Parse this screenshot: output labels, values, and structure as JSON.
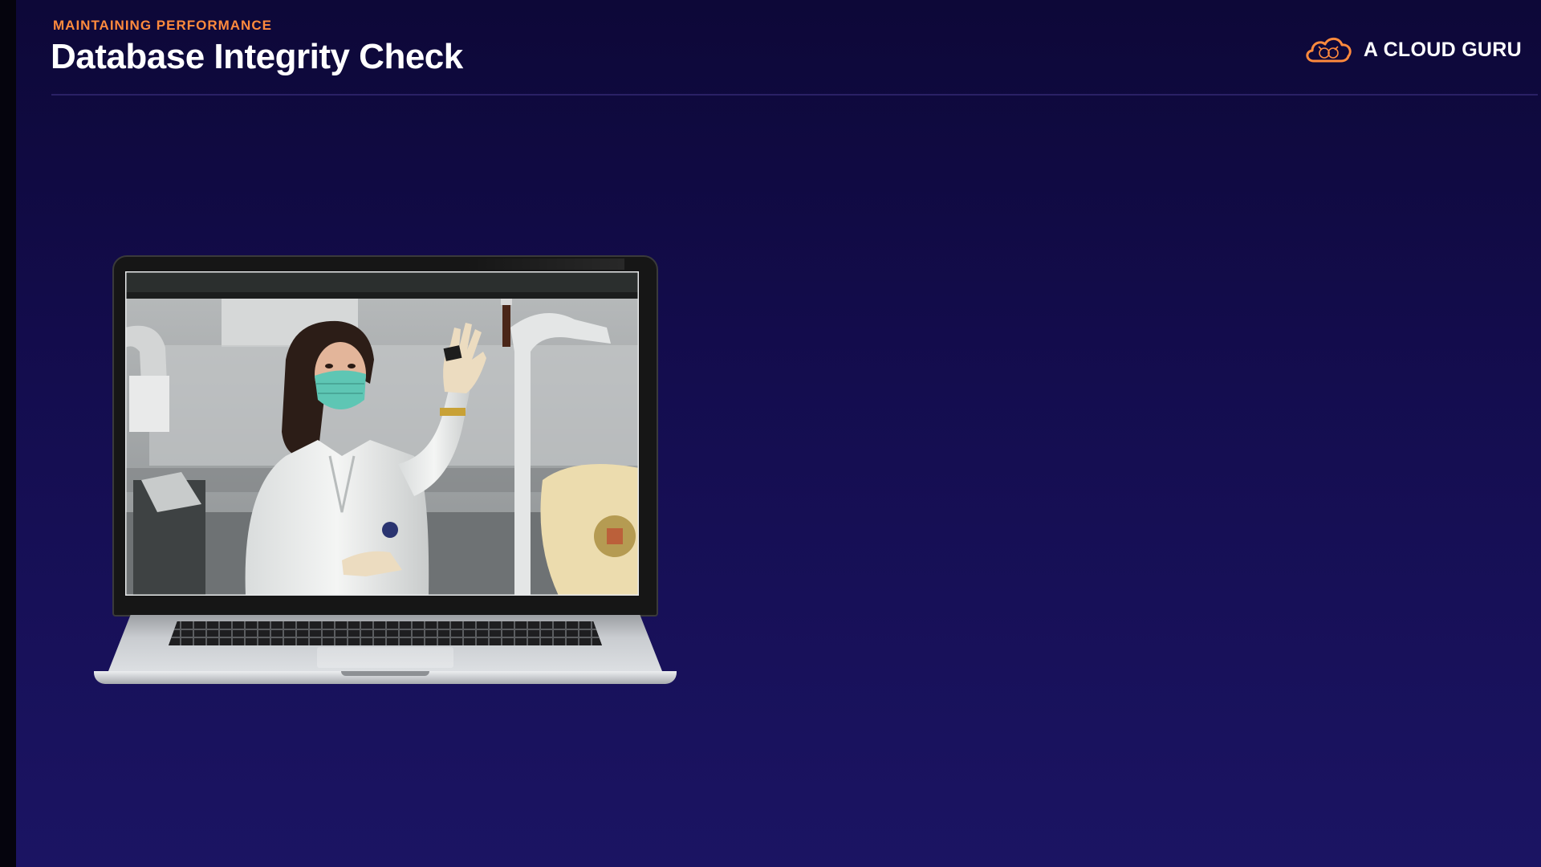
{
  "header": {
    "eyebrow": "MAINTAINING PERFORMANCE",
    "title": "Database Integrity Check"
  },
  "brand": {
    "name": "A CLOUD GURU",
    "icon": "cloud-guru-logo-icon",
    "accent_color": "#ff8a3d"
  },
  "colors": {
    "background_top": "#0d0838",
    "background_bottom": "#1b1463",
    "eyebrow": "#ff8a3d",
    "title": "#ffffff"
  },
  "media": {
    "type": "laptop-video-still",
    "subject": "lab-technician-image"
  }
}
